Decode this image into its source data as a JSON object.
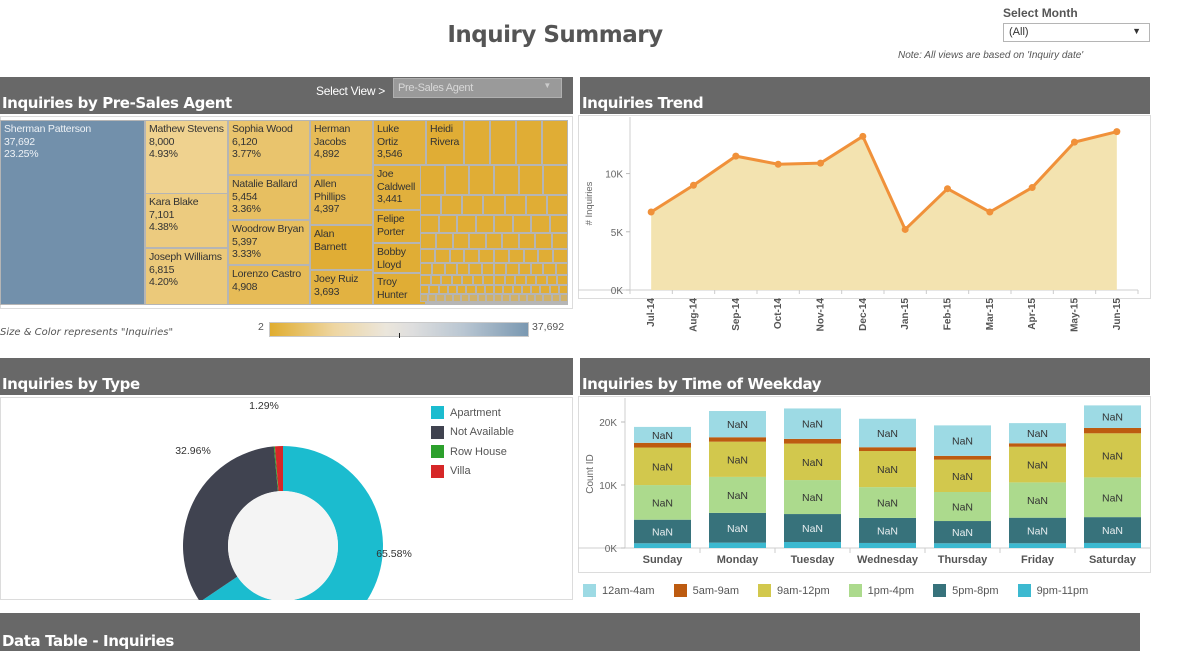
{
  "page": {
    "title": "Inquiry Summary",
    "month_filter": {
      "label": "Select Month",
      "value": "(All)"
    },
    "note": "Note: All views are based on 'Inquiry date'"
  },
  "panels": {
    "agent": {
      "title": "Inquiries by Pre-Sales Agent",
      "view_label": "Select View >",
      "view_value": "Pre-Sales Agent"
    },
    "trend": {
      "title": "Inquiries Trend"
    },
    "type": {
      "title": "Inquiries by Type"
    },
    "weekday": {
      "title": "Inquiries by Time of Weekday"
    },
    "table": {
      "title": "Data Table - Inquiries"
    }
  },
  "colors": {
    "header_bg": "#686868",
    "treemap_max": "#7290ab",
    "treemap_mid": "#efd28f",
    "treemap_min": "#e0ad35",
    "trend_line": "#f0913a",
    "trend_area": "#f3e3b0"
  },
  "chart_data": [
    {
      "type": "treemap",
      "title": "Inquiries by Pre-Sales Agent",
      "legend_caption": "Size & Color represents \"Inquiries\"",
      "color_range": {
        "min_label": "2",
        "max_label": "37,692",
        "min": 2,
        "max": 37692
      },
      "items": [
        {
          "name": "Sherman Patterson",
          "value": 37692,
          "value_label": "37,692",
          "pct": "23.25%"
        },
        {
          "name": "Mathew Stevens",
          "value": 8000,
          "value_label": "8,000",
          "pct": "4.93%"
        },
        {
          "name": "Kara Blake",
          "value": 7101,
          "value_label": "7,101",
          "pct": "4.38%"
        },
        {
          "name": "Joseph Williams",
          "value": 6815,
          "value_label": "6,815",
          "pct": "4.20%"
        },
        {
          "name": "Sophia Wood",
          "value": 6120,
          "value_label": "6,120",
          "pct": "3.77%"
        },
        {
          "name": "Natalie Ballard",
          "value": 5454,
          "value_label": "5,454",
          "pct": "3.36%"
        },
        {
          "name": "Woodrow Bryan",
          "value": 5397,
          "value_label": "5,397",
          "pct": "3.33%"
        },
        {
          "name": "Lorenzo Castro",
          "value": 4908,
          "value_label": "4,908",
          "pct": ""
        },
        {
          "name": "Herman Jacobs",
          "value": 4892,
          "value_label": "4,892",
          "pct": ""
        },
        {
          "name": "Allen Phillips",
          "value": 4397,
          "value_label": "4,397",
          "pct": ""
        },
        {
          "name": "Alan Barnett",
          "value": null,
          "value_label": "",
          "pct": ""
        },
        {
          "name": "Joey Ruiz",
          "value": 3693,
          "value_label": "3,693",
          "pct": ""
        },
        {
          "name": "Luke Ortiz",
          "value": 3546,
          "value_label": "3,546",
          "pct": ""
        },
        {
          "name": "Joe Caldwell",
          "value": 3441,
          "value_label": "3,441",
          "pct": ""
        },
        {
          "name": "Felipe Porter",
          "value": null,
          "value_label": "",
          "pct": ""
        },
        {
          "name": "Bobby Lloyd",
          "value": null,
          "value_label": "",
          "pct": ""
        },
        {
          "name": "Troy Hunter",
          "value": null,
          "value_label": "",
          "pct": ""
        },
        {
          "name": "Heidi Rivera",
          "value": null,
          "value_label": "",
          "pct": ""
        }
      ]
    },
    {
      "type": "area",
      "title": "Inquiries Trend",
      "xlabel": "",
      "ylabel": "# Inquiries",
      "ylim": [
        0,
        14000
      ],
      "yticks": [
        0,
        5000,
        10000
      ],
      "ytick_labels": [
        "0K",
        "5K",
        "10K"
      ],
      "x": [
        "Jul-14",
        "Aug-14",
        "Sep-14",
        "Oct-14",
        "Nov-14",
        "Dec-14",
        "Jan-15",
        "Feb-15",
        "Mar-15",
        "Apr-15",
        "May-15",
        "Jun-15"
      ],
      "values": [
        6700,
        9000,
        11500,
        10800,
        10900,
        13200,
        5200,
        8700,
        6700,
        8800,
        12700,
        13600
      ]
    },
    {
      "type": "pie",
      "title": "Inquiries by Type",
      "donut": true,
      "slices": [
        {
          "label": "Apartment",
          "pct": 65.58,
          "pct_label": "65.58%",
          "color": "#1bbccf"
        },
        {
          "label": "Not Available",
          "pct": 32.96,
          "pct_label": "32.96%",
          "color": "#404350"
        },
        {
          "label": "Row House",
          "pct": 0.17,
          "pct_label": "",
          "color": "#2ca02c"
        },
        {
          "label": "Villa",
          "pct": 1.29,
          "pct_label": "1.29%",
          "color": "#d62728"
        }
      ],
      "legend_position": "top-right"
    },
    {
      "type": "bar",
      "stacked": true,
      "title": "Inquiries by Time of Weekday",
      "xlabel": "",
      "ylabel": "Count ID",
      "ylim": [
        0,
        23000
      ],
      "yticks": [
        0,
        10000,
        20000
      ],
      "ytick_labels": [
        "0K",
        "10K",
        "20K"
      ],
      "categories": [
        "Sunday",
        "Monday",
        "Tuesday",
        "Wednesday",
        "Thursday",
        "Friday",
        "Saturday"
      ],
      "series": [
        {
          "name": "9pm-11pm",
          "color": "#3cb9d0",
          "label_color": "",
          "values": [
            750,
            850,
            950,
            800,
            750,
            750,
            800
          ]
        },
        {
          "name": "5pm-8pm",
          "color": "#37727b",
          "label_color": "#e8eef0",
          "values": [
            3740,
            4721,
            4440,
            3978,
            3531,
            4058,
            4101
          ]
        },
        {
          "name": "1pm-4pm",
          "color": "#acda8d",
          "label_color": "#333333",
          "values": [
            5501,
            5714,
            5393,
            4886,
            4608,
            5604,
            6303
          ]
        },
        {
          "name": "9am-12pm",
          "color": "#d2c84d",
          "label_color": "#333333",
          "values": [
            5954,
            5594,
            5790,
            5730,
            5139,
            5660,
            7001
          ]
        },
        {
          "name": "5am-9am",
          "color": "#bd5b10",
          "label_color": "",
          "values": [
            750,
            700,
            750,
            600,
            600,
            550,
            850
          ]
        },
        {
          "name": "12am-4am",
          "color": "#9ddae4",
          "label_color": "#333333",
          "values": [
            2525,
            4163,
            4827,
            4521,
            4835,
            3200,
            3581
          ]
        }
      ],
      "legend_order": [
        "12am-4am",
        "5am-9am",
        "9am-12pm",
        "1pm-4pm",
        "5pm-8pm",
        "9pm-11pm"
      ],
      "legend_position": "bottom"
    }
  ]
}
